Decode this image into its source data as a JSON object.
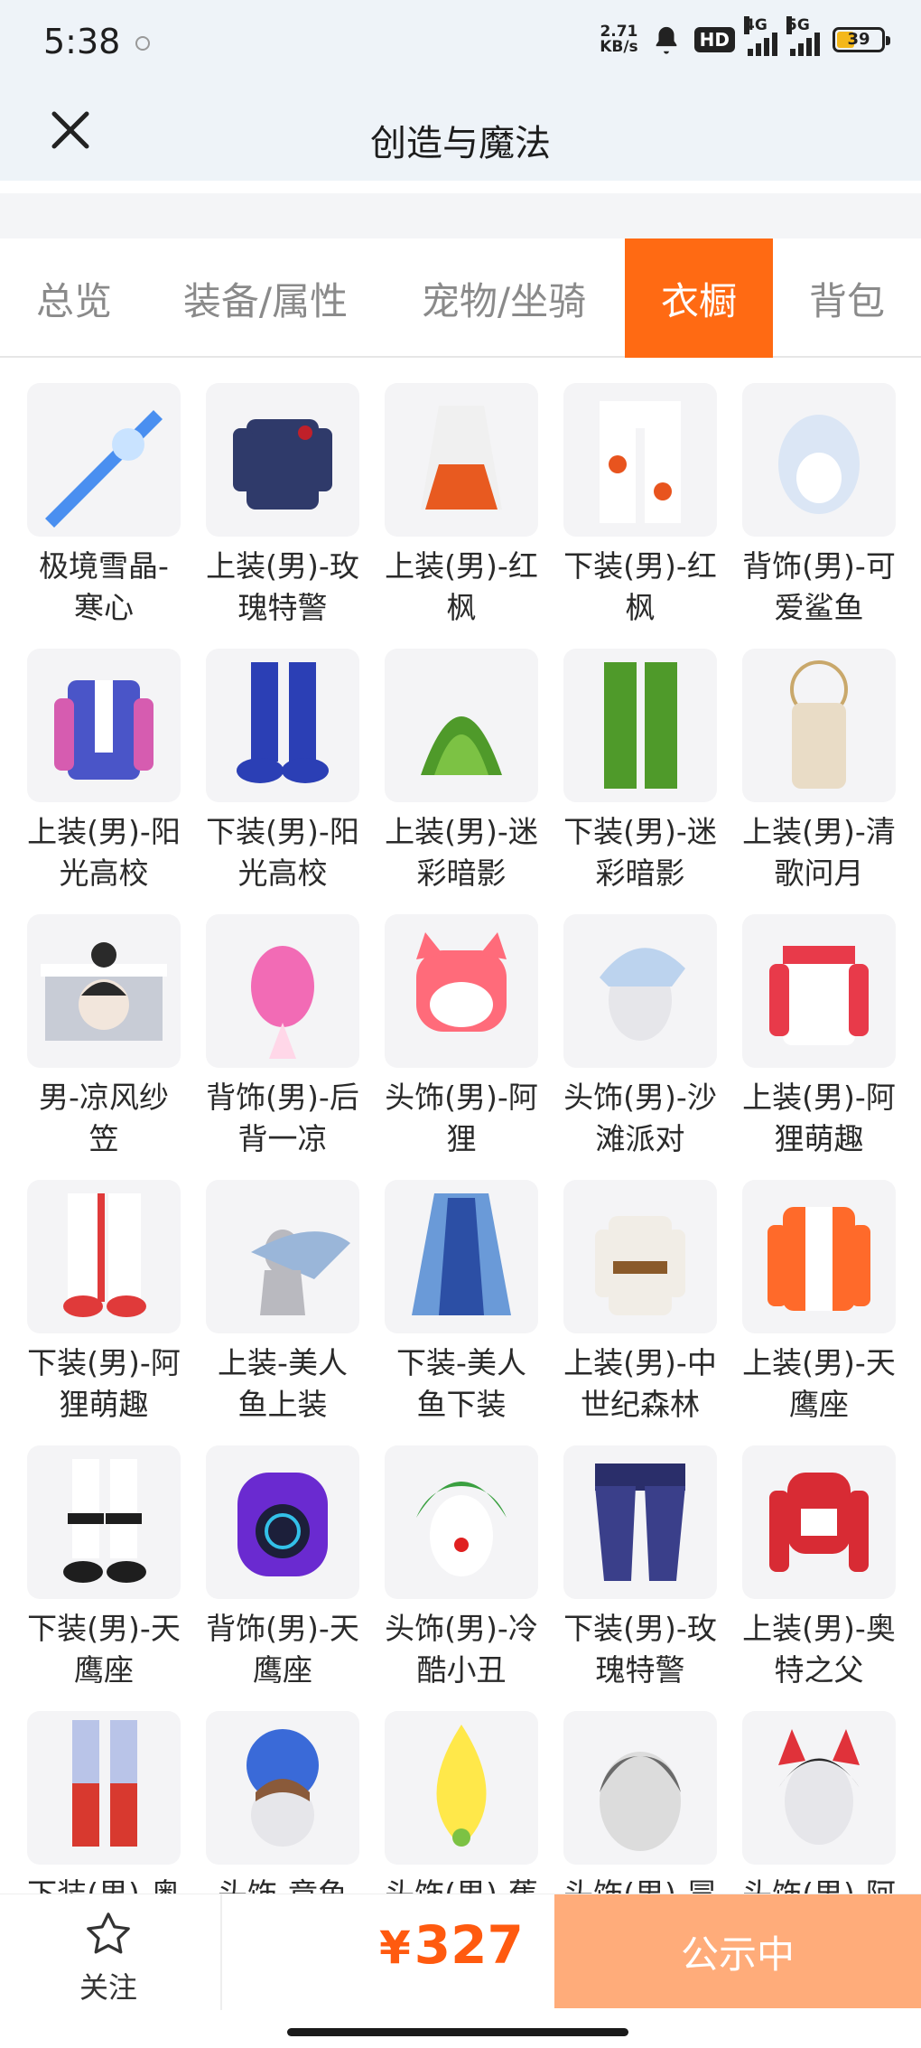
{
  "status_bar": {
    "time": "5:38",
    "net_speed_value": "2.71",
    "net_speed_unit": "KB/s",
    "hd_label": "HD",
    "net1": "4G",
    "net2": "5G",
    "battery": "39",
    "battery_level": 0.39,
    "battery_color": "#f4b81a"
  },
  "header": {
    "title": "创造与魔法",
    "close_icon": "close-icon"
  },
  "tabs": [
    {
      "label": "总览",
      "active": false
    },
    {
      "label": "装备/属性",
      "active": false
    },
    {
      "label": "宠物/坐骑",
      "active": false
    },
    {
      "label": "衣橱",
      "active": true
    },
    {
      "label": "背包",
      "active": false
    }
  ],
  "accent_color": "#ff6a13",
  "items": [
    {
      "label": "极境雪晶-寒心"
    },
    {
      "label": "上装(男)-玫瑰特警"
    },
    {
      "label": "上装(男)-红枫"
    },
    {
      "label": "下装(男)-红枫"
    },
    {
      "label": "背饰(男)-可爱鲨鱼"
    },
    {
      "label": "上装(男)-阳光高校"
    },
    {
      "label": "下装(男)-阳光高校"
    },
    {
      "label": "上装(男)-迷彩暗影"
    },
    {
      "label": "下装(男)-迷彩暗影"
    },
    {
      "label": "上装(男)-清歌问月"
    },
    {
      "label": "男-凉风纱笠"
    },
    {
      "label": "背饰(男)-后背一凉"
    },
    {
      "label": "头饰(男)-阿狸"
    },
    {
      "label": "头饰(男)-沙滩派对"
    },
    {
      "label": "上装(男)-阿狸萌趣"
    },
    {
      "label": "下装(男)-阿狸萌趣"
    },
    {
      "label": "上装-美人鱼上装"
    },
    {
      "label": "下装-美人鱼下装"
    },
    {
      "label": "上装(男)-中世纪森林"
    },
    {
      "label": "上装(男)-天鹰座"
    },
    {
      "label": "下装(男)-天鹰座"
    },
    {
      "label": "背饰(男)-天鹰座"
    },
    {
      "label": "头饰(男)-冷酷小丑"
    },
    {
      "label": "下装(男)-玫瑰特警"
    },
    {
      "label": "上装(男)-奥特之父"
    },
    {
      "label": "下装(男)-奥"
    },
    {
      "label": "头饰-章鱼"
    },
    {
      "label": "头饰(男)-蕉"
    },
    {
      "label": "头饰(男)-冒"
    },
    {
      "label": "头饰(男)-阿"
    }
  ],
  "bottom_bar": {
    "follow_label": "关注",
    "currency": "¥",
    "price": "327",
    "status_label": "公示中",
    "status_color": "#ffac7a"
  }
}
